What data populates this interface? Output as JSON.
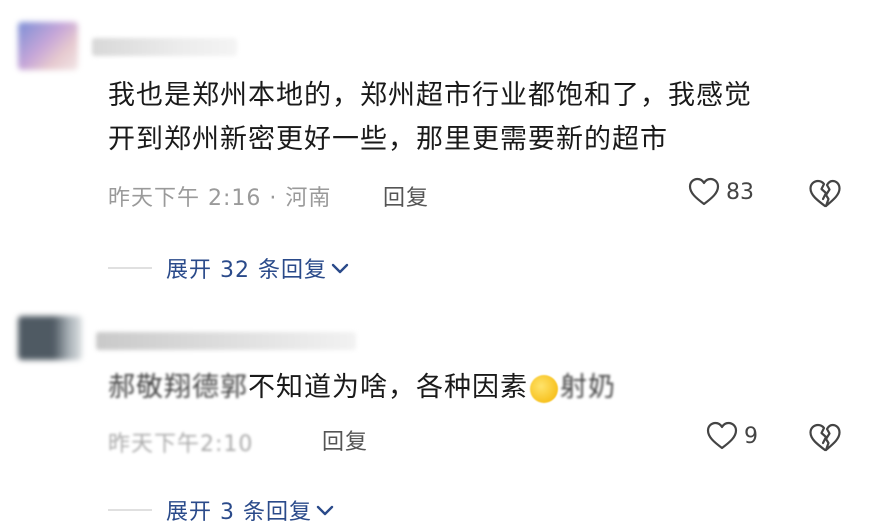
{
  "comments": [
    {
      "text_line1": "我也是郑州本地的，郑州超市行业都饱和了，我感觉",
      "text_line2": "开到郑州新密更好一些，那里更需要新的超市",
      "timestamp": "昨天下午 2:16",
      "separator": "·",
      "location": "河南",
      "reply_label": "回复",
      "like_count": "83",
      "expand_label": "展开 32 条回复"
    },
    {
      "text_blurred_prefix": "郝敬翔德郭",
      "text_visible": "不知道为啥，各种因素",
      "text_blurred_suffix": "射奶",
      "meta_blurred": "昨天下午2:10",
      "reply_label": "回复",
      "like_count": "9",
      "expand_label": "展开 3 条回复"
    }
  ],
  "colors": {
    "link": "#2a4a8a",
    "meta": "#9a9a9a",
    "text": "#1a1a1a"
  },
  "icons": {
    "like": "heart-outline-icon",
    "dislike": "broken-heart-icon",
    "expand": "chevron-down-icon"
  }
}
